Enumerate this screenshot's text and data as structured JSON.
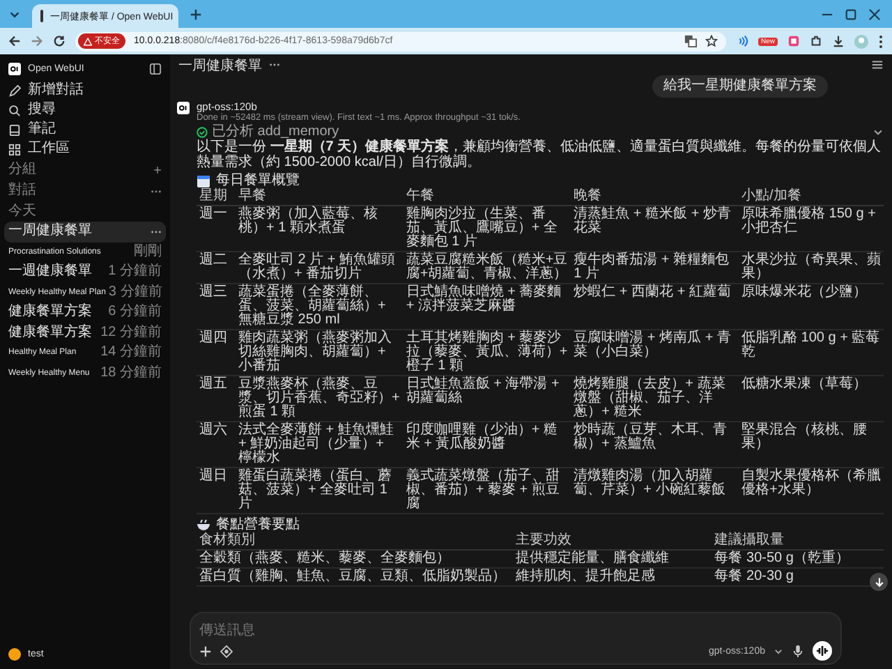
{
  "browser": {
    "tab_title": "一周健康餐單 / Open WebUI",
    "security_label": "不安全",
    "url_host": "10.0.0.218",
    "url_path": ":8080/c/f4e8176d-b226-4f17-8613-598a79d6b7cf",
    "extension_badge": "New"
  },
  "sidebar": {
    "app_name": "Open WebUI",
    "nav": [
      {
        "kind": "new",
        "label": "新增對話"
      },
      {
        "kind": "search",
        "label": "搜尋"
      },
      {
        "kind": "notes",
        "label": "筆記"
      },
      {
        "kind": "workspace",
        "label": "工作區"
      }
    ],
    "folders_label": "分組",
    "chats_label": "對話",
    "today_label": "今天",
    "chats": [
      {
        "title": "一周健康餐單",
        "selected": true
      },
      {
        "title": "Procrastination Solutions",
        "time": "剛剛",
        "selected": false
      },
      {
        "title": "一週健康餐單",
        "time": "1 分鐘前",
        "selected": false
      },
      {
        "title": "Weekly Healthy Meal Plan",
        "time": "3 分鐘前",
        "selected": false
      },
      {
        "title": "健康餐單方案",
        "time": "6 分鐘前",
        "selected": false
      },
      {
        "title": "健康餐單方案",
        "time": "12 分鐘前",
        "selected": false
      },
      {
        "title": "Healthy Meal Plan",
        "time": "14 分鐘前",
        "selected": false
      },
      {
        "title": "Weekly Healthy Menu",
        "time": "18 分鐘前",
        "selected": false
      }
    ],
    "user": "test"
  },
  "chat_title": "一周健康餐單",
  "user_message": "給我一星期健康餐單方案",
  "assistant": {
    "model": "gpt-oss:120b",
    "stats": "Done in ~52482 ms (stream view). First text ~1 ms. Approx throughput ~31 tok/s.",
    "tool_status": "已分析",
    "tool_name": "add_memory",
    "intro": "以下是一份 **一星期（7 天）健康餐單方案**，兼顧均衡營養、低油低鹽、適量蛋白質與纖維。每餐的份量可依個人熱量需求（約 1500-2000 kcal/日）自行微調。"
  },
  "menu_table": {
    "title": "每日餐單概覽",
    "columns": [
      "星期",
      "早餐",
      "午餐",
      "晚餐",
      "小點/加餐"
    ],
    "rows": [
      [
        "週一",
        "燕麥粥（加入藍莓、核桃）+ 1 顆水煮蛋",
        "雞胸肉沙拉（生菜、番茄、黃瓜、鷹嘴豆）+ 全麥麵包 1 片",
        "清蒸鮭魚 + 糙米飯 + 炒青花菜",
        "原味希臘優格 150 g + 小把杏仁"
      ],
      [
        "週二",
        "全麥吐司 2 片 + 鮪魚罐頭（水煮）+ 番茄切片",
        "蔬菜豆腐糙米飯（糙米+豆腐+胡蘿蔔、青椒、洋蔥）",
        "瘦牛肉番茄湯 + 雜糧麵包 1 片",
        "水果沙拉（奇異果、蘋果）"
      ],
      [
        "週三",
        "蔬菜蛋捲（全麥薄餅、蛋、菠菜、胡蘿蔔絲）+ 無糖豆漿 250 ml",
        "日式鯖魚味噌燒 + 蕎麥麵 + 涼拌菠菜芝麻醬",
        "炒蝦仁 + 西蘭花 + 紅蘿蔔",
        "原味爆米花（少鹽）"
      ],
      [
        "週四",
        "雞肉蔬菜粥（燕麥粥加入切絲雞胸肉、胡蘿蔔）+ 小番茄",
        "土耳其烤雞胸肉 + 藜麥沙拉（藜麥、黃瓜、薄荷）+ 橙子 1 顆",
        "豆腐味噌湯 + 烤南瓜 + 青菜（小白菜）",
        "低脂乳酪 100 g + 藍莓乾"
      ],
      [
        "週五",
        "豆漿燕麥杯（燕麥、豆漿、切片香蕉、奇亞籽）+ 煎蛋 1 顆",
        "日式鮭魚蓋飯 + 海帶湯 + 胡蘿蔔絲",
        "燒烤雞腿（去皮）+ 蔬菜燉盤（甜椒、茄子、洋蔥）+ 糙米",
        "低糖水果凍（草莓）"
      ],
      [
        "週六",
        "法式全麥薄餅 + 鮭魚燻鮭 + 鮮奶油起司（少量）+ 檸檬水",
        "印度咖哩雞（少油）+ 糙米 + 黃瓜酸奶醬",
        "炒時蔬（豆芽、木耳、青椒）+ 蒸鱸魚",
        "堅果混合（核桃、腰果）"
      ],
      [
        "週日",
        "雞蛋白蔬菜捲（蛋白、蘑菇、菠菜）+ 全麥吐司 1 片",
        "義式蔬菜燉盤（茄子、甜椒、番茄）+ 藜麥 + 煎豆腐",
        "清燉雞肉湯（加入胡蘿蔔、芹菜）+ 小碗紅藜飯",
        "自製水果優格杯（希臘優格+水果）"
      ]
    ]
  },
  "nutrition_table": {
    "title": "餐點營養要點",
    "columns": [
      "食材類別",
      "主要功效",
      "建議攝取量"
    ],
    "rows": [
      [
        "全穀類（燕麥、糙米、藜麥、全麥麵包）",
        "提供穩定能量、膳食纖維",
        "每餐 30-50 g（乾重）"
      ],
      [
        "蛋白質（雞胸、鮭魚、豆腐、豆類、低脂奶製品）",
        "維持肌肉、提升飽足感",
        "每餐 20-30 g"
      ]
    ]
  },
  "composer": {
    "placeholder": "傳送訊息",
    "model": "gpt-oss:120b"
  }
}
